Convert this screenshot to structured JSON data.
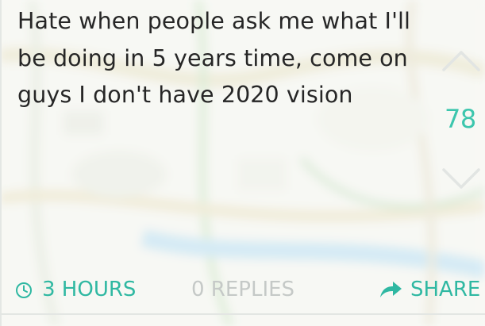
{
  "post": {
    "text": "Hate when people ask me what I'll be doing in 5 years time, come on guys I don't have 2020 vision"
  },
  "votes": {
    "count": "78",
    "upvote_icon": "chevron-up-icon",
    "downvote_icon": "chevron-down-icon"
  },
  "footer": {
    "time_icon": "clock-icon",
    "time_label": "3 HOURS",
    "replies_label": "0 REPLIES",
    "share_icon": "share-arrow-icon",
    "share_label": "SHARE"
  },
  "colors": {
    "accent": "#2fb8a2",
    "muted": "#c5c9c7",
    "text": "#262626"
  }
}
